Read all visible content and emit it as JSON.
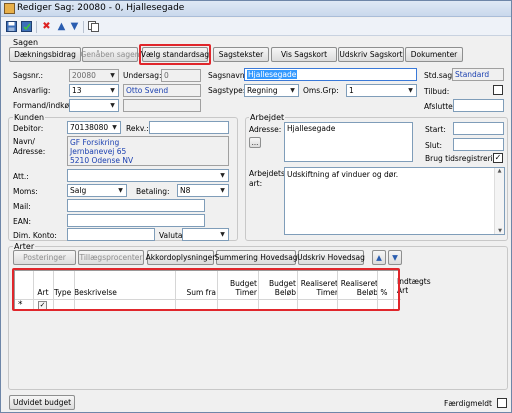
{
  "window": {
    "title": "Rediger Sag: 20080 - 0, Hjallesegade"
  },
  "section_sagen": "Sagen",
  "tabs": {
    "daekningsbidrag": "Dækningsbidrag",
    "genaaben": "Genåben sagen",
    "vaelg_standardsag": "Vælg standardsag",
    "sagstekster": "Sagstekster",
    "vis_sagskort": "Vis Sagskort",
    "udskriv_sagskort": "Udskriv Sagskort",
    "dokumenter": "Dokumenter"
  },
  "case": {
    "sagsnr_label": "Sagsnr.:",
    "sagsnr_value": "20080",
    "undersag_label": "Undersag:",
    "undersag_value": "0",
    "sagsnavn_label": "Sagsnavn:",
    "sagsnavn_value": "Hjallesegade",
    "stdsag_label": "Std.sag:",
    "stdsag_value": "Standard",
    "ansvarlig_label": "Ansvarlig:",
    "ansvarlig_value": "13",
    "ansvarlig_name": "Otto Svend",
    "sagstype_label": "Sagstype:",
    "sagstype_value": "Regning",
    "omsgrp_label": "Oms.Grp:",
    "omsgrp_value": "1",
    "tilbud_label": "Tilbud:",
    "formand_label": "Formand/indkøber",
    "afsluttet_label": "Afsluttet:"
  },
  "kunden": {
    "title": "Kunden",
    "debitor_label": "Debitor:",
    "debitor_value": "70138080",
    "rekv_label": "Rekv.:",
    "navn_label": "Navn/\nAdresse:",
    "address_lines": [
      "GF Forsikring",
      "Jernbanevej 65",
      "5210 Odense NV"
    ],
    "att_label": "Att.:",
    "moms_label": "Moms:",
    "moms_value": "Salg",
    "betaling_label": "Betaling:",
    "betaling_value": "N8",
    "mail_label": "Mail:",
    "ean_label": "EAN:",
    "dimkonto_label": "Dim. Konto:",
    "valuta_label": "Valuta:"
  },
  "arbejdet": {
    "title": "Arbejdet",
    "adresse_label": "Adresse:",
    "adresse_value": "Hjallesegade",
    "ellipsis": "...",
    "start_label": "Start:",
    "slut_label": "Slut:",
    "brug_label": "Brug tidsregistrering",
    "art_label": "Arbejdets\nart:",
    "art_value": "Udskiftning af vinduer og dør."
  },
  "arter": {
    "title": "Arter",
    "posteringer": "Posteringer",
    "tillaeg": "Tillægsprocenter",
    "akkord": "Akkordoplysninger",
    "summering": "Summering Hovedsag",
    "udskriv": "Udskriv Hovedsag",
    "columns": {
      "art": "Art",
      "type": "Type",
      "beskrivelse": "Beskrivelse",
      "sumfra": "Sum fra",
      "budget_timer": "Budget\nTimer",
      "budget_beloeb": "Budget\nBeløb",
      "real_timer": "Realiseret\nTimer",
      "real_beloeb": "Realiseret\nBeløb",
      "pct": "%",
      "indtaegts": "Indtægts\nArt"
    },
    "new_row_marker": "*"
  },
  "footer": {
    "udvidet": "Udvidet budget",
    "faerdigmeldt": "Færdigmeldt"
  }
}
